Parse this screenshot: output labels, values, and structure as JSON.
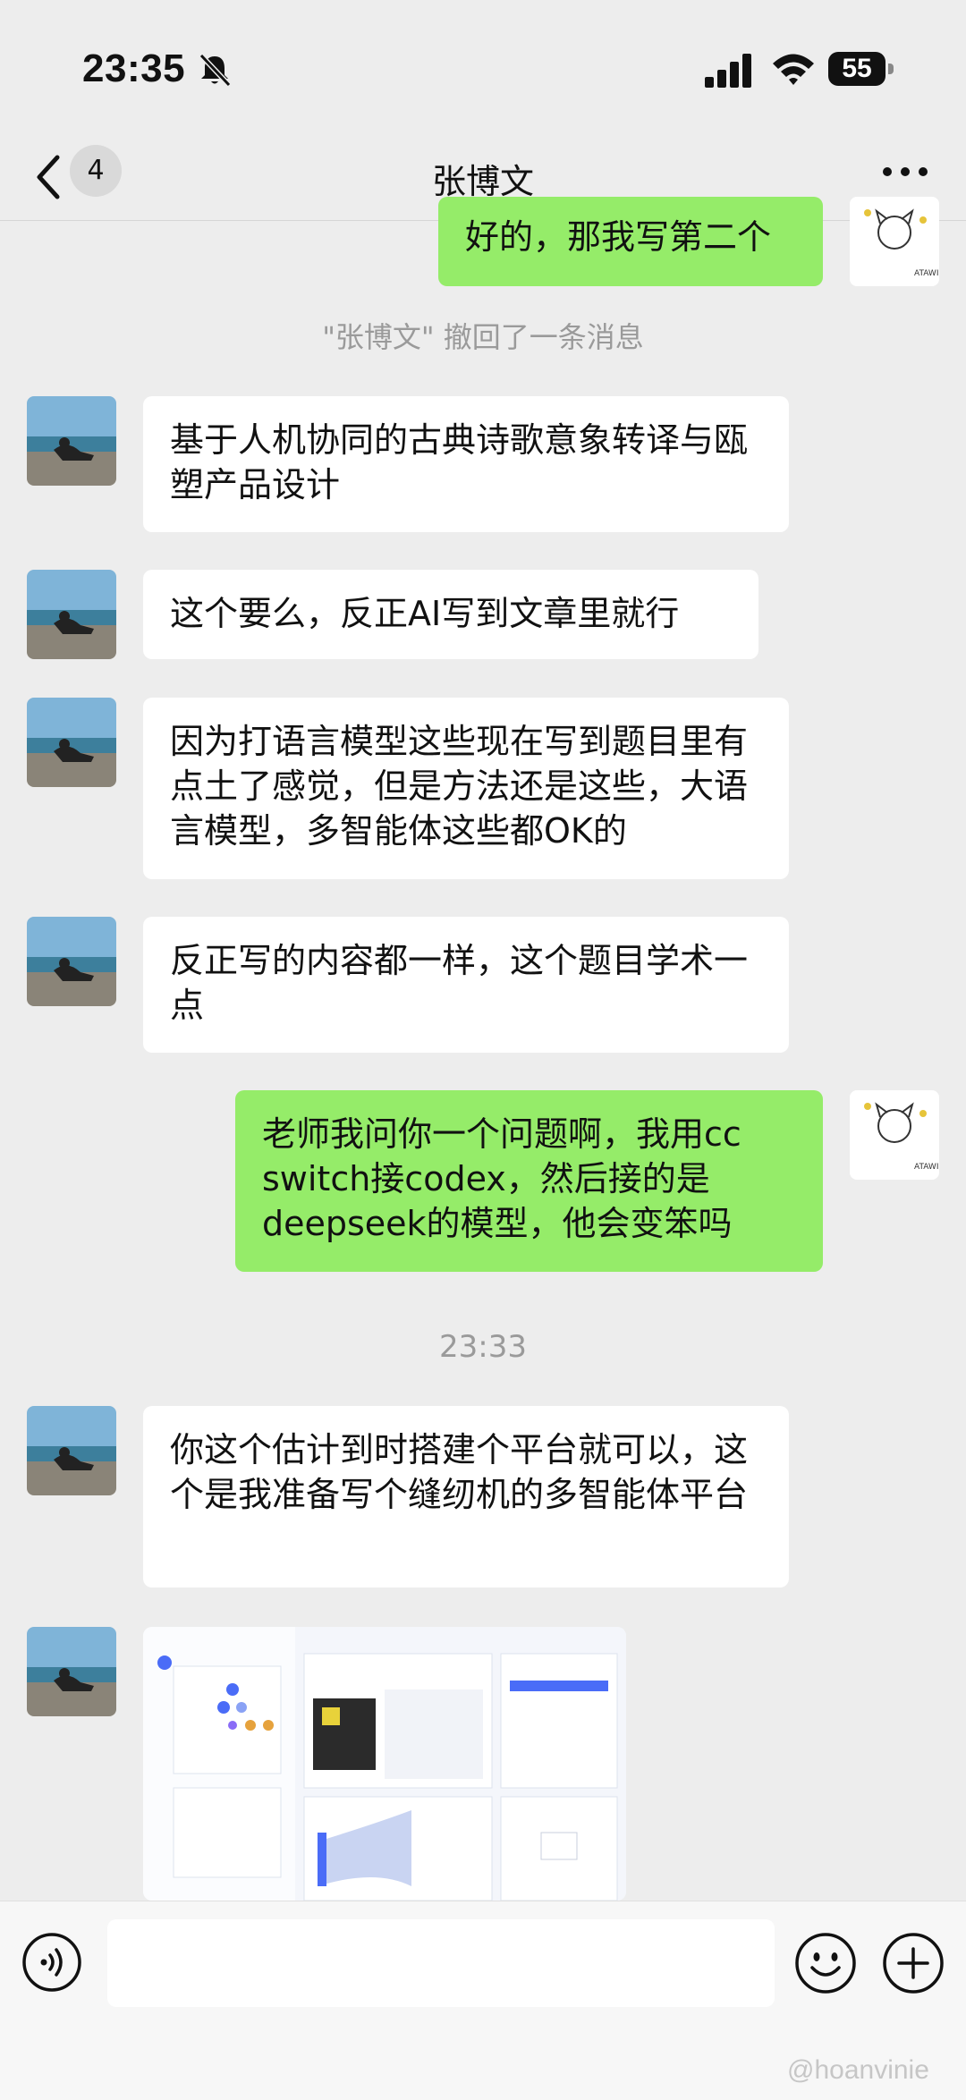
{
  "status": {
    "time": "23:35",
    "battery": "55"
  },
  "header": {
    "unread_count": "4",
    "contact_name": "张博文"
  },
  "messages": {
    "m1": "好的，那我写第二个",
    "recall": "\"张博文\" 撤回了一条消息",
    "m2": "基于人机协同的古典诗歌意象转译与瓯塑产品设计",
    "m3": "这个要么，反正AI写到文章里就行",
    "m4": "因为打语言模型这些现在写到题目里有点土了感觉，但是方法还是这些，大语言模型，多智能体这些都OK的",
    "m5": "反正写的内容都一样，这个题目学术一点",
    "m6": "老师我问你一个问题啊，我用cc switch接codex，然后接的是deepseek的模型，他会变笨吗",
    "timestamp": "23:33",
    "m7": "你这个估计到时搭建个平台就可以，这个是我准备写个缝纫机的多智能体平台"
  },
  "footer": {
    "watermark": "@hoanvinie"
  },
  "colors": {
    "background": "#ededed",
    "my_bubble": "#95ec69",
    "their_bubble": "#ffffff"
  },
  "icons": [
    "back-chevron-icon",
    "mute-bell-icon",
    "signal-icon",
    "wifi-icon",
    "battery-icon",
    "more-dots-icon",
    "voice-icon",
    "emoji-icon",
    "plus-icon"
  ]
}
